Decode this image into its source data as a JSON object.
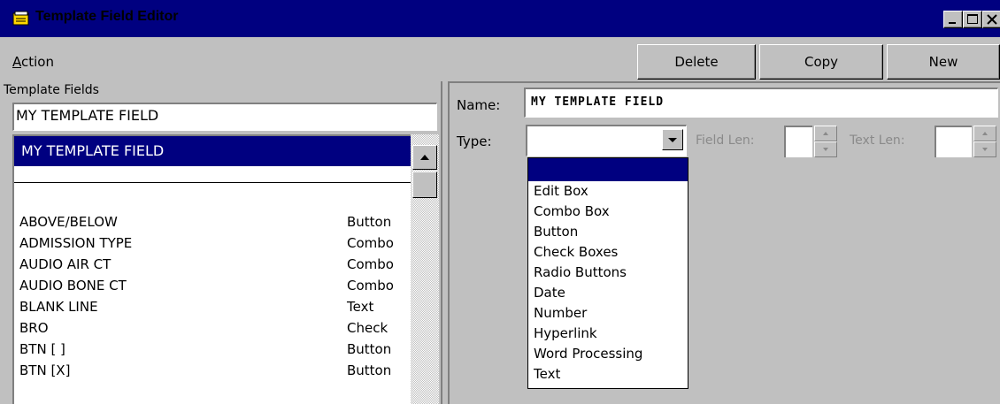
{
  "window": {
    "title": "Template Field Editor",
    "accent_color": "#000080"
  },
  "menu": {
    "action_first": "A",
    "action_rest": "ction"
  },
  "toolbar": {
    "delete_label": "Delete",
    "copy_label": "Copy",
    "new_label": "New"
  },
  "template_fields": {
    "label": "Template Fields",
    "filter_value": "MY TEMPLATE FIELD",
    "selected_item": "MY TEMPLATE FIELD",
    "items": [
      {
        "name": "ABOVE/BELOW",
        "type": "Button"
      },
      {
        "name": "ADMISSION TYPE",
        "type": "Combo"
      },
      {
        "name": "AUDIO AIR CT",
        "type": "Combo"
      },
      {
        "name": "AUDIO BONE CT",
        "type": "Combo"
      },
      {
        "name": "BLANK LINE",
        "type": "Text"
      },
      {
        "name": "BRO",
        "type": "Check"
      },
      {
        "name": "BTN [ ]",
        "type": "Button"
      },
      {
        "name": "BTN [X]",
        "type": "Button"
      }
    ]
  },
  "editor": {
    "name_label": "Name:",
    "name_value": "MY TEMPLATE FIELD",
    "type_label": "Type:",
    "type_value": "",
    "field_len_label": "Field Len:",
    "text_len_label": "Text Len:",
    "type_options": [
      "Edit Box",
      "Combo Box",
      "Button",
      "Check Boxes",
      "Radio Buttons",
      "Date",
      "Number",
      "Hyperlink",
      "Word Processing",
      "Text"
    ]
  }
}
